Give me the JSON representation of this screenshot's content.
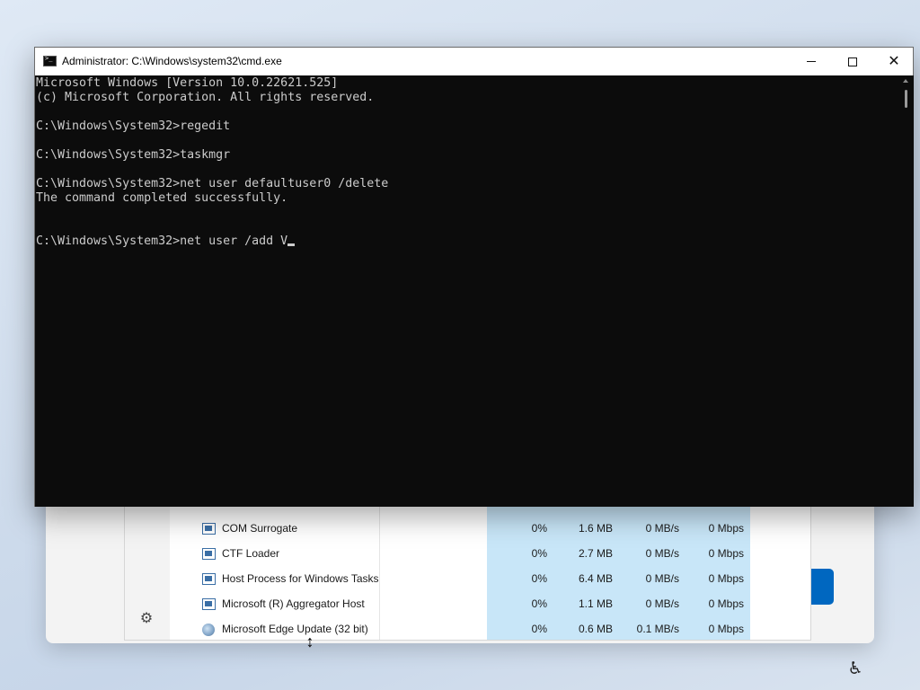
{
  "window": {
    "title": "Administrator: C:\\Windows\\system32\\cmd.exe",
    "minimize_icon": "minimize-icon",
    "maximize_icon": "maximize-icon",
    "close_icon": "close-icon"
  },
  "console": {
    "lines": [
      "Microsoft Windows [Version 10.0.22621.525]",
      "(c) Microsoft Corporation. All rights reserved.",
      "",
      "C:\\Windows\\System32>regedit",
      "",
      "C:\\Windows\\System32>taskmgr",
      "",
      "C:\\Windows\\System32>net user defaultuser0 /delete",
      "The command completed successfully.",
      "",
      "",
      "C:\\Windows\\System32>net user /add V"
    ],
    "text_color": "#cccccc",
    "background_color": "#0c0c0c"
  },
  "taskmanager": {
    "rows": [
      {
        "name": "COM Surrogate",
        "cpu": "0%",
        "memory": "1.6 MB",
        "disk": "0 MB/s",
        "network": "0 Mbps",
        "icon": "process-icon"
      },
      {
        "name": "CTF Loader",
        "cpu": "0%",
        "memory": "2.7 MB",
        "disk": "0 MB/s",
        "network": "0 Mbps",
        "icon": "process-icon"
      },
      {
        "name": "Host Process for Windows Tasks",
        "cpu": "0%",
        "memory": "6.4 MB",
        "disk": "0 MB/s",
        "network": "0 Mbps",
        "icon": "process-icon"
      },
      {
        "name": "Microsoft (R) Aggregator Host",
        "cpu": "0%",
        "memory": "1.1 MB",
        "disk": "0 MB/s",
        "network": "0 Mbps",
        "icon": "process-icon"
      },
      {
        "name": "Microsoft Edge Update (32 bit)",
        "cpu": "0%",
        "memory": "0.6 MB",
        "disk": "0.1 MB/s",
        "network": "0 Mbps",
        "icon": "edge-update-icon"
      }
    ],
    "settings_icon": "gear-icon",
    "highlight_color": "#c8e6f8"
  },
  "setup": {
    "accent_color": "#0067c0"
  },
  "taskbar": {
    "accessibility_icon": "accessibility-icon"
  }
}
